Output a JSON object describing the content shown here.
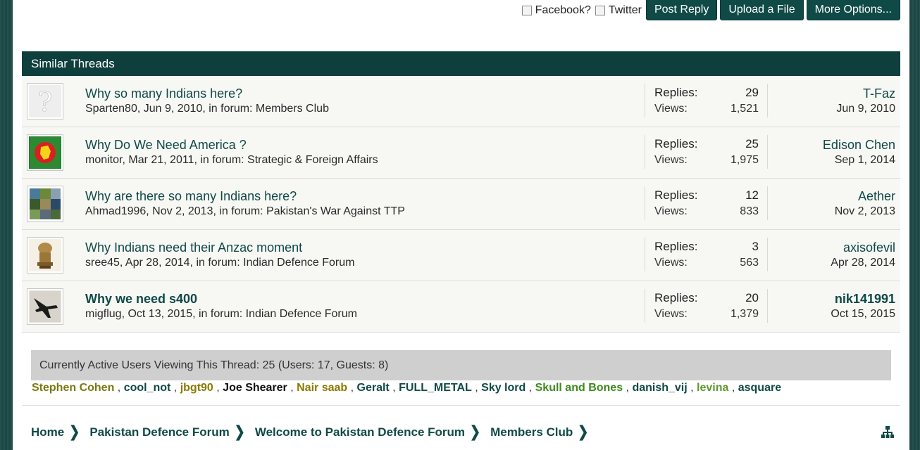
{
  "actions": {
    "facebook_label": "Facebook?",
    "twitter_label": "Twitter",
    "post_reply": "Post Reply",
    "upload_file": "Upload a File",
    "more_options": "More Options..."
  },
  "similar": {
    "heading": "Similar Threads",
    "replies_label": "Replies:",
    "views_label": "Views:",
    "threads": [
      {
        "title": "Why so many Indians here?",
        "meta": "Sparten80, Jun 9, 2010, in forum: Members Club",
        "replies": "29",
        "views": "1,521",
        "last_user": "T-Faz",
        "last_date": "Jun 9, 2010",
        "avatar": "placeholder-avatar"
      },
      {
        "title": "Why Do We Need America ?",
        "meta": "monitor, Mar 21, 2011, in forum: Strategic & Foreign Affairs",
        "replies": "25",
        "views": "1,975",
        "last_user": "Edison Chen",
        "last_date": "Sep 1, 2014",
        "avatar": "bangladesh-flag-avatar"
      },
      {
        "title": "Why are there so many Indians here?",
        "meta": "Ahmad1996, Nov 2, 2013, in forum: Pakistan's War Against TTP",
        "replies": "12",
        "views": "833",
        "last_user": "Aether",
        "last_date": "Nov 2, 2013",
        "avatar": "collage-avatar"
      },
      {
        "title": "Why Indians need their Anzac moment",
        "meta": "sree45, Apr 28, 2014, in forum: Indian Defence Forum",
        "replies": "3",
        "views": "563",
        "last_user": "axisofevil",
        "last_date": "Apr 28, 2014",
        "avatar": "emblem-avatar"
      },
      {
        "title": "Why we need s400",
        "meta": "migflug, Oct 13, 2015, in forum: Indian Defence Forum",
        "replies": "20",
        "views": "1,379",
        "last_user": "nik141991",
        "last_date": "Oct 15, 2015",
        "avatar": "jet-avatar"
      }
    ]
  },
  "active_users": {
    "summary": "Currently Active Users Viewing This Thread: 25 (Users: 17, Guests: 8)",
    "users": [
      {
        "name": "Stephen Cohen",
        "color": "#7a7a10"
      },
      {
        "name": "cool_not",
        "color": "#0f4a47"
      },
      {
        "name": "jbgt90",
        "color": "#8a7a00"
      },
      {
        "name": "Joe Shearer",
        "color": "#111111"
      },
      {
        "name": "Nair saab",
        "color": "#8a7a00"
      },
      {
        "name": "Geralt",
        "color": "#0f4a47"
      },
      {
        "name": "FULL_METAL",
        "color": "#0f4a47"
      },
      {
        "name": "Sky lord",
        "color": "#0f4a47"
      },
      {
        "name": "Skull and Bones",
        "color": "#3e8a1e"
      },
      {
        "name": "danish_vij",
        "color": "#0f4a47"
      },
      {
        "name": "levina",
        "color": "#5e9a2e"
      },
      {
        "name": "asquare",
        "color": "#0f4a47"
      }
    ]
  },
  "breadcrumb": [
    "Home",
    "Pakistan Defence Forum",
    "Welcome to Pakistan Defence Forum",
    "Members Club"
  ],
  "colors": {
    "brand": "#0f4a47",
    "header": "#0e3f3d"
  }
}
